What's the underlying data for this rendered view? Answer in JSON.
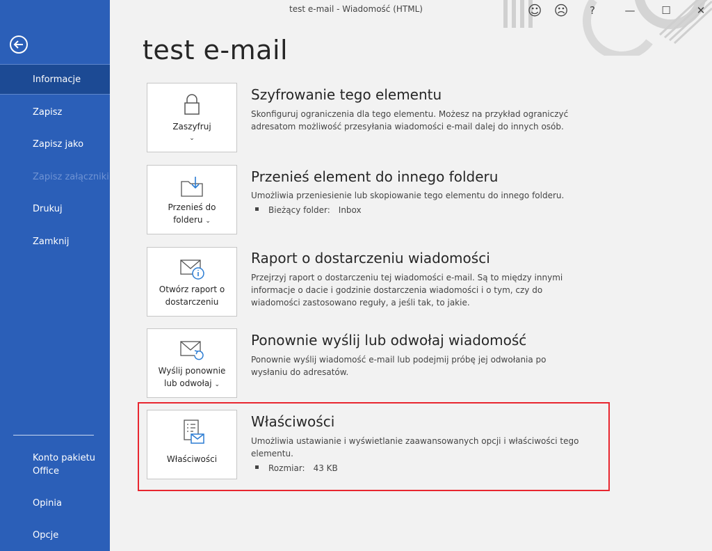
{
  "window": {
    "title": "test e-mail  -  Wiadomość (HTML)",
    "controls": {
      "smile": "☺",
      "frown": "☹",
      "help": "?",
      "minimize": "—",
      "maximize": "☐",
      "close": "✕"
    }
  },
  "sidebar": {
    "back_icon": "arrow-left-circle-icon",
    "items": [
      {
        "label": "Informacje",
        "state": "active"
      },
      {
        "label": "Zapisz",
        "state": "normal"
      },
      {
        "label": "Zapisz jako",
        "state": "normal"
      },
      {
        "label": "Zapisz załączniki",
        "state": "disabled"
      },
      {
        "label": "Drukuj",
        "state": "normal"
      },
      {
        "label": "Zamknij",
        "state": "normal"
      }
    ],
    "bottom_items": [
      {
        "label": "Konto pakietu Office"
      },
      {
        "label": "Opinia"
      },
      {
        "label": "Opcje"
      }
    ]
  },
  "main": {
    "page_title": "test e-mail",
    "sections": [
      {
        "button_label": "Zaszyfruj",
        "button_icon": "lock-icon",
        "has_dropdown": true,
        "title": "Szyfrowanie tego elementu",
        "description": "Skonfiguruj ograniczenia dla tego elementu. Możesz na przykład ograniczyć adresatom możliwość przesyłania wiadomości e-mail dalej do innych osób."
      },
      {
        "button_label": "Przenieś do folderu",
        "button_label_line1": "Przenieś do",
        "button_label_line2": "folderu",
        "button_icon": "move-to-folder-icon",
        "has_dropdown": true,
        "title": "Przenieś element do innego folderu",
        "description": "Umożliwia przeniesienie lub skopiowanie tego elementu do innego folderu.",
        "bullet": {
          "label": "Bieżący folder:",
          "value": "Inbox"
        }
      },
      {
        "button_label_line1": "Otwórz raport o",
        "button_label_line2": "dostarczeniu",
        "button_icon": "mail-info-icon",
        "has_dropdown": false,
        "title": "Raport o dostarczeniu wiadomości",
        "description": "Przejrzyj raport o dostarczeniu tej wiadomości e-mail. Są to między innymi informacje o dacie i godzinie dostarczenia wiadomości i o tym, czy do wiadomości zastosowano reguły, a jeśli tak, to jakie."
      },
      {
        "button_label_line1": "Wyślij ponownie",
        "button_label_line2": "lub odwołaj",
        "button_icon": "mail-resend-icon",
        "has_dropdown": true,
        "title": "Ponownie wyślij lub odwołaj wiadomość",
        "description": "Ponownie wyślij wiadomość e-mail lub podejmij próbę jej odwołania po wysłaniu do adresatów."
      },
      {
        "button_label": "Właściwości",
        "button_icon": "properties-icon",
        "has_dropdown": false,
        "title": "Właściwości",
        "description": "Umożliwia ustawianie i wyświetlanie zaawansowanych opcji i właściwości tego elementu.",
        "bullet": {
          "label": "Rozmiar:",
          "value": "43 KB"
        },
        "highlighted": true
      }
    ]
  },
  "colors": {
    "sidebar": "#2b5fb8",
    "sidebar_active": "#1c4a94",
    "highlight": "#e8262f",
    "icon_blue": "#2b7cd3"
  }
}
